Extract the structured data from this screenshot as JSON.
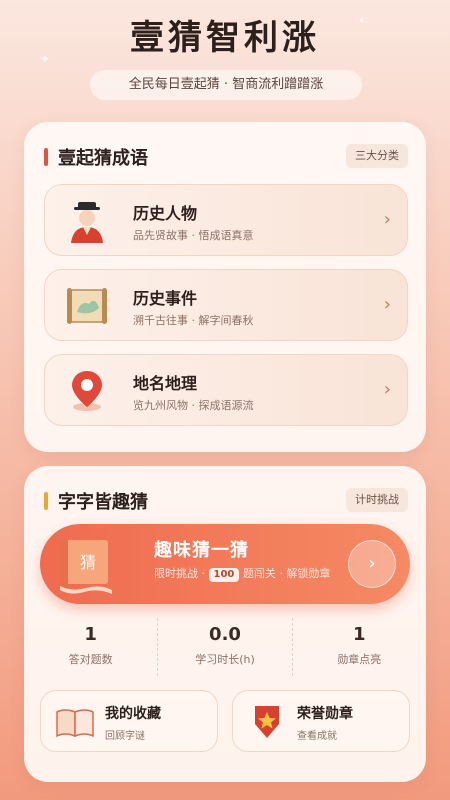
{
  "header": {
    "title": "壹猜智利涨",
    "subtitle": "全民每日壹起猜 · 智商流利蹭蹭涨"
  },
  "idioms": {
    "title": "壹起猜成语",
    "tag": "三大分类",
    "categories": [
      {
        "name": "历史人物",
        "desc": "品先贤故事 · 悟成语真意",
        "icon": "scholar-figure-icon"
      },
      {
        "name": "历史事件",
        "desc": "溯千古往事 · 解字间春秋",
        "icon": "ancient-scroll-map-icon"
      },
      {
        "name": "地名地理",
        "desc": "览九州风物 · 探成语源流",
        "icon": "location-pin-icon"
      }
    ]
  },
  "fun": {
    "title": "字字皆趣猜",
    "tag": "计时挑战",
    "banner": {
      "title": "趣味猜一猜",
      "desc_before": "限时挑战 · ",
      "badge": "100",
      "desc_after": " 题闯关 · 解锁勋章",
      "scroll_char": "猜"
    },
    "stats": [
      {
        "value": "1",
        "label": "答对题数"
      },
      {
        "value": "0.0",
        "label": "学习时长(h)"
      },
      {
        "value": "1",
        "label": "勋章点亮"
      }
    ],
    "tiles": [
      {
        "name": "我的收藏",
        "desc": "回顾字谜",
        "icon": "open-book-icon"
      },
      {
        "name": "荣誉勋章",
        "desc": "查看成就",
        "icon": "star-medal-icon"
      }
    ]
  },
  "colors": {
    "accent": "#e0553c",
    "gold": "#e5a935"
  }
}
